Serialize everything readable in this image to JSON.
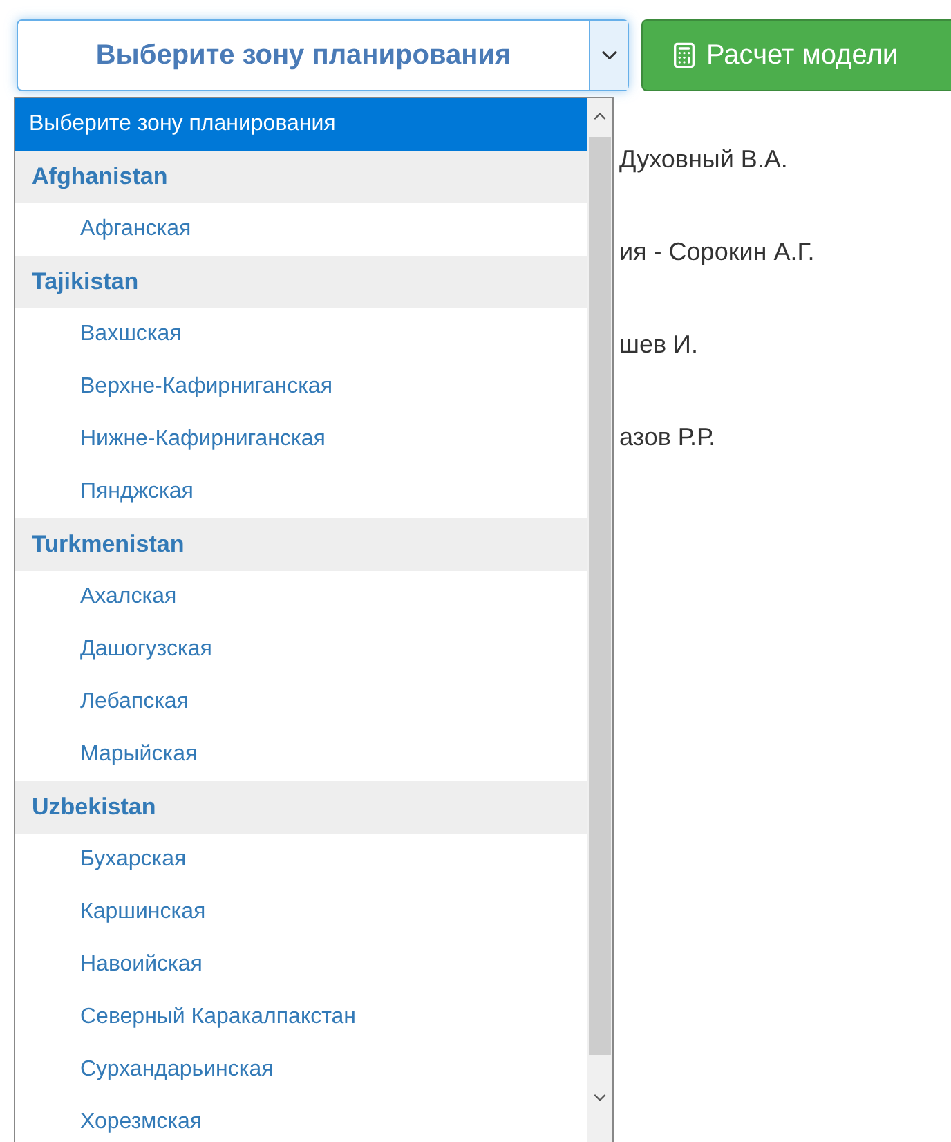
{
  "select": {
    "value": "Выберите зону планирования",
    "expanded": true
  },
  "button": {
    "label": "Расчет модели"
  },
  "options": [
    {
      "kind": "option",
      "label": "Выберите зону планирования",
      "selected": true
    },
    {
      "kind": "group",
      "label": "Afghanistan",
      "children": [
        {
          "label": "Афганская",
          "selected": false
        }
      ]
    },
    {
      "kind": "group",
      "label": "Tajikistan",
      "children": [
        {
          "label": "Вахшская",
          "selected": false
        },
        {
          "label": "Верхне-Кафирниганская",
          "selected": false
        },
        {
          "label": "Нижне-Кафирниганская",
          "selected": false
        },
        {
          "label": "Пянджская",
          "selected": false
        }
      ]
    },
    {
      "kind": "group",
      "label": "Turkmenistan",
      "children": [
        {
          "label": "Ахалская",
          "selected": false
        },
        {
          "label": "Дашогузская",
          "selected": false
        },
        {
          "label": "Лебапская",
          "selected": false
        },
        {
          "label": "Марыйская",
          "selected": false
        }
      ]
    },
    {
      "kind": "group",
      "label": "Uzbekistan",
      "children": [
        {
          "label": "Бухарская",
          "selected": false
        },
        {
          "label": "Каршинская",
          "selected": false
        },
        {
          "label": "Навоийская",
          "selected": false
        },
        {
          "label": "Северный Каракалпакстан",
          "selected": false
        },
        {
          "label": "Сурхандарьинская",
          "selected": false
        },
        {
          "label": "Хорезмская",
          "selected": false
        }
      ]
    }
  ],
  "background_lines": [
    "Духовный В.А.",
    "ия - Сорокин А.Г.",
    "шев И.",
    "азов Р.Р."
  ]
}
